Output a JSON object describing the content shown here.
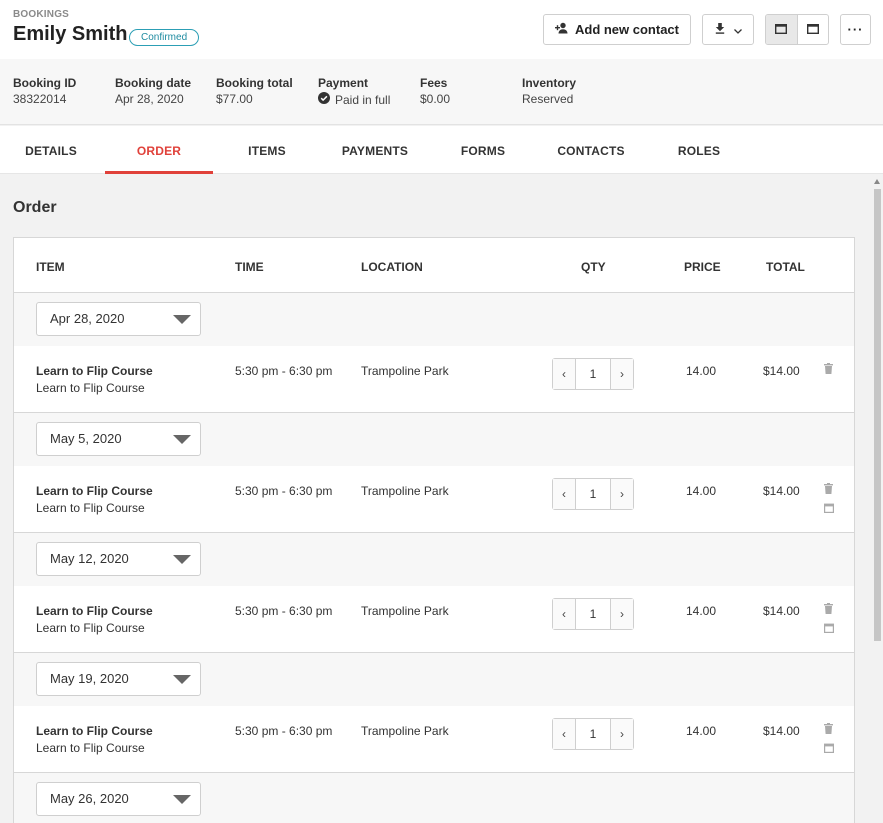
{
  "header": {
    "breadcrumb": "BOOKINGS",
    "name": "Emily Smith",
    "status_badge": "Confirmed",
    "add_contact_label": "Add new contact",
    "more_label": "···"
  },
  "summary": {
    "booking_id": {
      "label": "Booking ID",
      "value": "38322014"
    },
    "booking_date": {
      "label": "Booking date",
      "value": "Apr 28, 2020"
    },
    "booking_total": {
      "label": "Booking total",
      "value": "$77.00"
    },
    "payment": {
      "label": "Payment",
      "value": "Paid in full"
    },
    "fees": {
      "label": "Fees",
      "value": "$0.00"
    },
    "inventory": {
      "label": "Inventory",
      "value": "Reserved"
    }
  },
  "tabs": [
    {
      "label": "DETAILS"
    },
    {
      "label": "ORDER",
      "active": true
    },
    {
      "label": "ITEMS"
    },
    {
      "label": "PAYMENTS"
    },
    {
      "label": "FORMS"
    },
    {
      "label": "CONTACTS"
    },
    {
      "label": "ROLES"
    }
  ],
  "order": {
    "title": "Order",
    "columns": {
      "item": "ITEM",
      "time": "TIME",
      "location": "LOCATION",
      "qty": "QTY",
      "price": "PRICE",
      "total": "TOTAL"
    },
    "groups": [
      {
        "date": "Apr 28, 2020",
        "item": {
          "title": "Learn to Flip Course",
          "subtitle": "Learn to Flip Course",
          "time": "5:30 pm - 6:30 pm",
          "location": "Trampoline Park",
          "qty": "1",
          "price": "14.00",
          "total": "$14.00",
          "show_calendar": false
        }
      },
      {
        "date": "May 5, 2020",
        "item": {
          "title": "Learn to Flip Course",
          "subtitle": "Learn to Flip Course",
          "time": "5:30 pm - 6:30 pm",
          "location": "Trampoline Park",
          "qty": "1",
          "price": "14.00",
          "total": "$14.00",
          "show_calendar": true
        }
      },
      {
        "date": "May 12, 2020",
        "item": {
          "title": "Learn to Flip Course",
          "subtitle": "Learn to Flip Course",
          "time": "5:30 pm - 6:30 pm",
          "location": "Trampoline Park",
          "qty": "1",
          "price": "14.00",
          "total": "$14.00",
          "show_calendar": true
        }
      },
      {
        "date": "May 19, 2020",
        "item": {
          "title": "Learn to Flip Course",
          "subtitle": "Learn to Flip Course",
          "time": "5:30 pm - 6:30 pm",
          "location": "Trampoline Park",
          "qty": "1",
          "price": "14.00",
          "total": "$14.00",
          "show_calendar": true
        }
      },
      {
        "date": "May 26, 2020"
      }
    ]
  },
  "colors": {
    "accent": "#e0413a",
    "badge": "#2c9fb5"
  }
}
